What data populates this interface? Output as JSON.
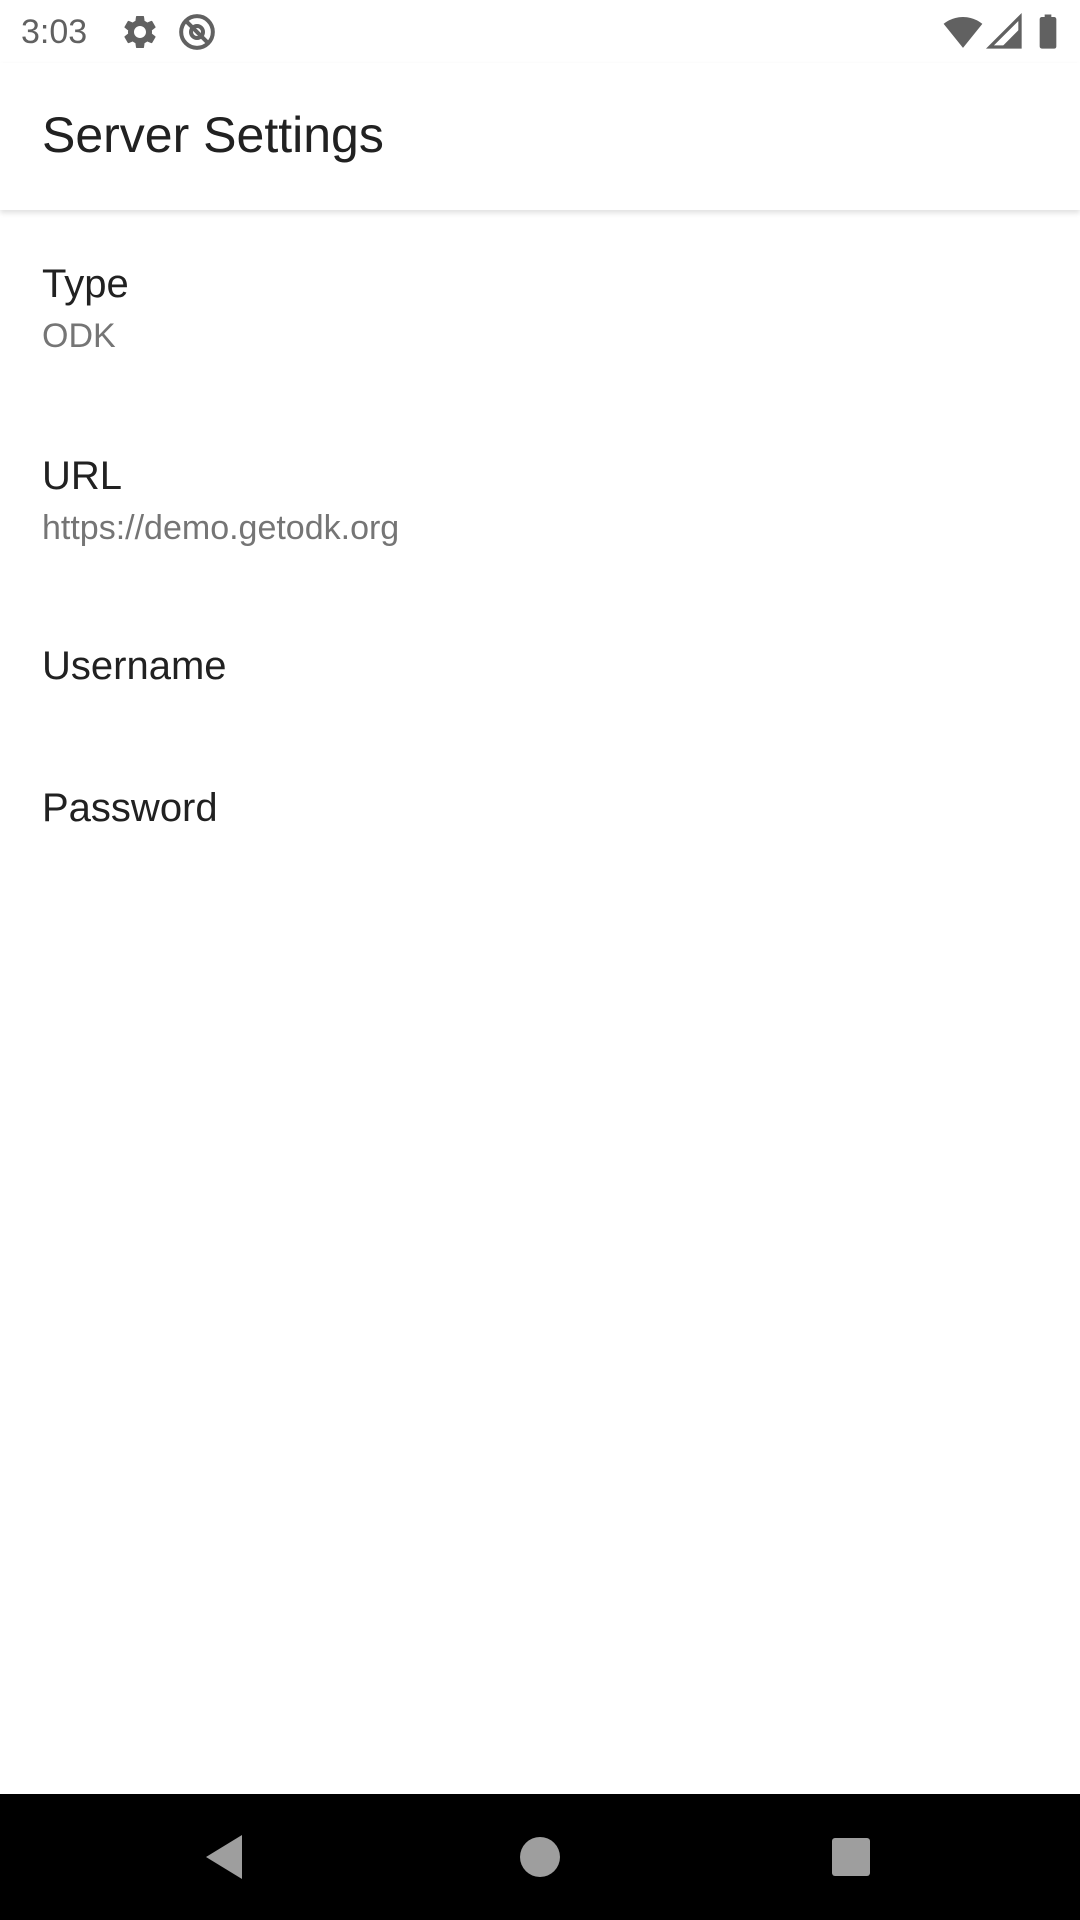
{
  "status_bar": {
    "time": "3:03",
    "icons": [
      "gear-icon",
      "at-sign-icon",
      "wifi-icon",
      "signal-icon",
      "battery-icon"
    ]
  },
  "app_bar": {
    "title": "Server Settings"
  },
  "preferences": [
    {
      "title": "Type",
      "summary": "ODK"
    },
    {
      "title": "URL",
      "summary": "https://demo.getodk.org"
    },
    {
      "title": "Username",
      "summary": ""
    },
    {
      "title": "Password",
      "summary": ""
    }
  ],
  "nav_bar": {
    "buttons": [
      "back-icon",
      "home-icon",
      "recents-icon"
    ]
  },
  "colors": {
    "title_text": "#212121",
    "summary_text": "#757575",
    "status_icons": "#616161",
    "nav_background": "#000000"
  }
}
